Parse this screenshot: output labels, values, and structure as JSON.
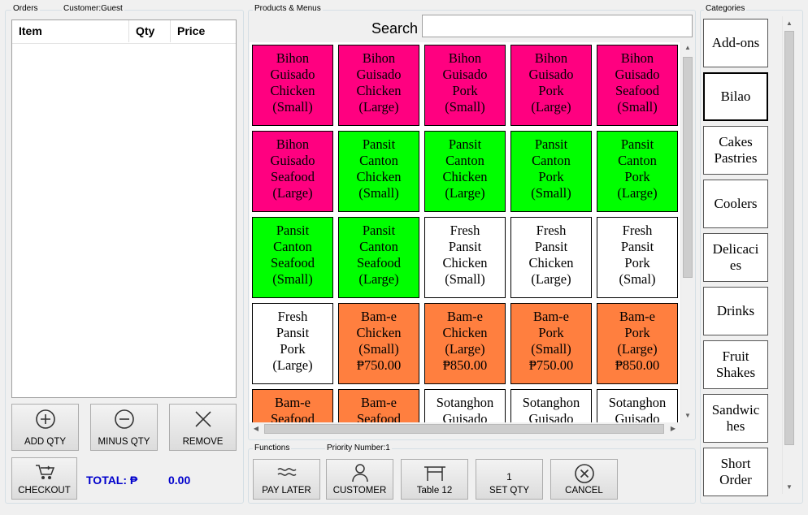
{
  "orders": {
    "legend": "Orders",
    "customer_legend": "Customer:Guest",
    "columns": [
      "Item",
      "Qty",
      "Price"
    ],
    "buttons": {
      "add_qty": "ADD QTY",
      "minus_qty": "MINUS QTY",
      "remove": "REMOVE",
      "checkout": "CHECKOUT"
    },
    "total_label": "TOTAL: ₱",
    "total_value": "0.00"
  },
  "products": {
    "legend": "Products & Menus",
    "search_label": "Search",
    "search_value": "",
    "items": [
      {
        "label": "Bihon\nGuisado\nChicken\n(Small)",
        "color": "#ff0080"
      },
      {
        "label": "Bihon\nGuisado\nChicken\n(Large)",
        "color": "#ff0080"
      },
      {
        "label": "Bihon\nGuisado\nPork\n(Small)",
        "color": "#ff0080"
      },
      {
        "label": "Bihon\nGuisado\nPork\n(Large)",
        "color": "#ff0080"
      },
      {
        "label": "Bihon\nGuisado\nSeafood\n(Small)",
        "color": "#ff0080"
      },
      {
        "label": "Bihon\nGuisado\nSeafood\n(Large)",
        "color": "#ff0080"
      },
      {
        "label": "Pansit\nCanton\nChicken\n(Small)",
        "color": "#00ff00"
      },
      {
        "label": "Pansit\nCanton\nChicken\n(Large)",
        "color": "#00ff00"
      },
      {
        "label": "Pansit\nCanton\nPork\n(Small)",
        "color": "#00ff00"
      },
      {
        "label": "Pansit\nCanton\nPork\n(Large)",
        "color": "#00ff00"
      },
      {
        "label": "Pansit\nCanton\nSeafood\n(Small)",
        "color": "#00ff00"
      },
      {
        "label": "Pansit\nCanton\nSeafood\n(Large)",
        "color": "#00ff00"
      },
      {
        "label": "Fresh\nPansit\nChicken\n(Small)",
        "color": "#ffffff"
      },
      {
        "label": "Fresh\nPansit\nChicken\n(Large)",
        "color": "#ffffff"
      },
      {
        "label": "Fresh\nPansit\nPork\n(Smal)",
        "color": "#ffffff"
      },
      {
        "label": "Fresh\nPansit\nPork\n(Large)",
        "color": "#ffffff"
      },
      {
        "label": "Bam-e\nChicken\n(Small)\n₱750.00",
        "color": "#ff7f3f"
      },
      {
        "label": "Bam-e\nChicken\n(Large)\n₱850.00",
        "color": "#ff7f3f"
      },
      {
        "label": "Bam-e\nPork\n(Small)\n₱750.00",
        "color": "#ff7f3f"
      },
      {
        "label": "Bam-e\nPork\n(Large)\n₱850.00",
        "color": "#ff7f3f"
      },
      {
        "label": "Bam-e\nSeafood",
        "color": "#ff7f3f"
      },
      {
        "label": "Bam-e\nSeafood",
        "color": "#ff7f3f"
      },
      {
        "label": "Sotanghon\nGuisado",
        "color": "#ffffff"
      },
      {
        "label": "Sotanghon\nGuisado",
        "color": "#ffffff"
      },
      {
        "label": "Sotanghon\nGuisado",
        "color": "#ffffff"
      }
    ]
  },
  "functions": {
    "legend": "Functions",
    "priority_legend": "Priority Number:1",
    "buttons": {
      "pay_later": "PAY LATER",
      "customer": "CUSTOMER",
      "table": "Table 12",
      "set_qty": "SET QTY",
      "set_qty_value": "1",
      "cancel": "CANCEL"
    }
  },
  "categories": {
    "legend": "Categories",
    "items": [
      "Add-ons",
      "Bilao",
      "Cakes\nPastries",
      "Coolers",
      "Delicaci\nes",
      "Drinks",
      "Fruit\nShakes",
      "Sandwic\nhes",
      "Short\nOrder"
    ],
    "selected": "Bilao"
  },
  "icons": {
    "add": "plus-circle-icon",
    "minus": "minus-circle-icon",
    "remove": "x-icon",
    "checkout": "cart-icon",
    "pay_later": "wave-icon",
    "customer": "person-icon",
    "table": "table-icon",
    "cancel": "x-circle-icon"
  },
  "colors": {
    "total": "#0000cc"
  }
}
